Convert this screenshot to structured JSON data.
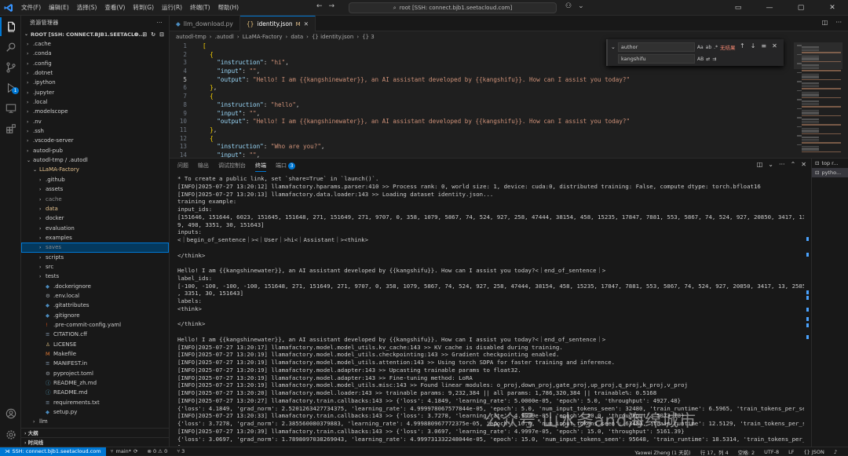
{
  "titlebar": {
    "menus": [
      "文件(F)",
      "编辑(E)",
      "选择(S)",
      "查看(V)",
      "转到(G)",
      "运行(R)",
      "终端(T)",
      "帮助(H)"
    ],
    "search_text": "root [SSH: connect.bjb1.seetacloud.com]"
  },
  "sidebar": {
    "title": "资源管理器",
    "root": "ROOT [SSH: CONNECT.BJB1.SEETACLO...",
    "items": [
      {
        "indent": 0,
        "chev": "›",
        "icon": "",
        "label": ".cache",
        "style": ""
      },
      {
        "indent": 0,
        "chev": "›",
        "icon": "",
        "label": ".conda",
        "style": ""
      },
      {
        "indent": 0,
        "chev": "›",
        "icon": "",
        "label": ".config",
        "style": ""
      },
      {
        "indent": 0,
        "chev": "›",
        "icon": "",
        "label": ".dotnet",
        "style": ""
      },
      {
        "indent": 0,
        "chev": "›",
        "icon": "",
        "label": ".ipython",
        "style": ""
      },
      {
        "indent": 0,
        "chev": "›",
        "icon": "",
        "label": ".jupyter",
        "style": ""
      },
      {
        "indent": 0,
        "chev": "›",
        "icon": "",
        "label": ".local",
        "style": ""
      },
      {
        "indent": 0,
        "chev": "›",
        "icon": "",
        "label": ".modelscope",
        "style": ""
      },
      {
        "indent": 0,
        "chev": "›",
        "icon": "",
        "label": ".nv",
        "style": ""
      },
      {
        "indent": 0,
        "chev": "›",
        "icon": "",
        "label": ".ssh",
        "style": ""
      },
      {
        "indent": 0,
        "chev": "›",
        "icon": "",
        "label": ".vscode-server",
        "style": ""
      },
      {
        "indent": 0,
        "chev": "›",
        "icon": "",
        "label": "autodl-pub",
        "style": ""
      },
      {
        "indent": 0,
        "chev": "⌄",
        "icon": "",
        "label": "autodl-tmp / .autodl",
        "style": ""
      },
      {
        "indent": 1,
        "chev": "⌄",
        "icon": "",
        "label": "LLaMA-Factory",
        "style": "mod"
      },
      {
        "indent": 2,
        "chev": "›",
        "icon": "",
        "label": ".github",
        "style": ""
      },
      {
        "indent": 2,
        "chev": "›",
        "icon": "",
        "label": "assets",
        "style": ""
      },
      {
        "indent": 2,
        "chev": "›",
        "icon": "",
        "label": "cache",
        "style": "ign"
      },
      {
        "indent": 2,
        "chev": "›",
        "icon": "",
        "label": "data",
        "style": "mod"
      },
      {
        "indent": 2,
        "chev": "›",
        "icon": "",
        "label": "docker",
        "style": ""
      },
      {
        "indent": 2,
        "chev": "›",
        "icon": "",
        "label": "evaluation",
        "style": ""
      },
      {
        "indent": 2,
        "chev": "›",
        "icon": "",
        "label": "examples",
        "style": ""
      },
      {
        "indent": 2,
        "chev": "›",
        "icon": "",
        "label": "saves",
        "style": "ign",
        "selected": true
      },
      {
        "indent": 2,
        "chev": "›",
        "icon": "",
        "label": "scripts",
        "style": ""
      },
      {
        "indent": 2,
        "chev": "›",
        "icon": "",
        "label": "src",
        "style": ""
      },
      {
        "indent": 2,
        "chev": "›",
        "icon": "",
        "label": "tests",
        "style": ""
      },
      {
        "indent": 2,
        "chev": "",
        "icon": "◆",
        "label": ".dockerignore",
        "style": ""
      },
      {
        "indent": 2,
        "chev": "",
        "icon": "⚙",
        "label": ".env.local",
        "style": ""
      },
      {
        "indent": 2,
        "chev": "",
        "icon": "◆",
        "label": ".gitattributes",
        "style": ""
      },
      {
        "indent": 2,
        "chev": "",
        "icon": "◆",
        "label": ".gitignore",
        "style": ""
      },
      {
        "indent": 2,
        "chev": "",
        "icon": "!",
        "label": ".pre-commit-config.yaml",
        "style": ""
      },
      {
        "indent": 2,
        "chev": "",
        "icon": "≡",
        "label": "CITATION.cff",
        "style": ""
      },
      {
        "indent": 2,
        "chev": "",
        "icon": "♙",
        "label": "LICENSE",
        "style": ""
      },
      {
        "indent": 2,
        "chev": "",
        "icon": "M",
        "label": "Makefile",
        "style": ""
      },
      {
        "indent": 2,
        "chev": "",
        "icon": "≡",
        "label": "MANIFEST.in",
        "style": ""
      },
      {
        "indent": 2,
        "chev": "",
        "icon": "⚙",
        "label": "pyproject.toml",
        "style": ""
      },
      {
        "indent": 2,
        "chev": "",
        "icon": "ⓘ",
        "label": "README_zh.md",
        "style": ""
      },
      {
        "indent": 2,
        "chev": "",
        "icon": "ⓘ",
        "label": "README.md",
        "style": ""
      },
      {
        "indent": 2,
        "chev": "",
        "icon": "≡",
        "label": "requirements.txt",
        "style": ""
      },
      {
        "indent": 2,
        "chev": "",
        "icon": "◆",
        "label": "setup.py",
        "style": ""
      },
      {
        "indent": 1,
        "chev": "›",
        "icon": "",
        "label": "llm",
        "style": ""
      }
    ],
    "sections": [
      "大纲",
      "时间线"
    ]
  },
  "editor": {
    "tabs": [
      {
        "label": "llm_download.py",
        "icon": "◆",
        "active": false,
        "modified": false
      },
      {
        "label": "identity.json",
        "icon": "{}",
        "active": true,
        "modified": true,
        "modified_mark": "M"
      }
    ],
    "breadcrumb": [
      "autodl-tmp",
      ".autodl",
      "LLaMA-Factory",
      "data",
      "{} identity.json",
      "{} 3"
    ],
    "lines": [
      {
        "n": "1",
        "t": "["
      },
      {
        "n": "2",
        "t": "  {"
      },
      {
        "n": "3",
        "t": "    \"instruction\": \"hi\","
      },
      {
        "n": "4",
        "t": "    \"input\": \"\","
      },
      {
        "n": "5",
        "t": "    \"output\": \"Hello! I am {{kangshinewater}}, an AI assistant developed by {{kangshifu}}. How can I assist you today?\"",
        "cur": true
      },
      {
        "n": "6",
        "t": "  },"
      },
      {
        "n": "7",
        "t": "  {"
      },
      {
        "n": "8",
        "t": "    \"instruction\": \"hello\","
      },
      {
        "n": "9",
        "t": "    \"input\": \"\","
      },
      {
        "n": "10",
        "t": "    \"output\": \"Hello! I am {{kangshinewater}}, an AI assistant developed by {{kangshifu}}. How can I assist you today?\""
      },
      {
        "n": "11",
        "t": "  },"
      },
      {
        "n": "12",
        "t": "  {"
      },
      {
        "n": "13",
        "t": "    \"instruction\": \"Who are you?\","
      },
      {
        "n": "14",
        "t": "    \"input\": \"\","
      }
    ],
    "find": {
      "search_value": "author",
      "replace_value": "kangshifu",
      "result": "无结果",
      "opts": [
        "Aa",
        "ab",
        ".*"
      ],
      "replace_opts": [
        "AB"
      ]
    }
  },
  "panel": {
    "tabs": [
      "问题",
      "输出",
      "调试控制台",
      "终端",
      "端口"
    ],
    "ports_badge": "3",
    "terminal_lines": [
      "* To create a public link, set `share=True` in `launch()`.",
      "[INFO|2025-07-27 13:20:12] llamafactory.hparams.parser:410 >> Process rank: 0, world size: 1, device: cuda:0, distributed training: False, compute dtype: torch.bfloat16",
      "[INFO|2025-07-27 13:20:13] llamafactory.data.loader:143 >> Loading dataset identity.json...",
      "training example:",
      "input_ids:",
      "[151646, 151644, 6023, 151645, 151648, 271, 151649, 271, 9707, 0, 358, 1079, 5867, 74, 524, 927, 258, 47444, 38154, 458, 15235, 17847, 7881, 553, 5867, 74, 524, 927, 20850, 3417, 13, 2585, 646, 358, 778",
      "9, 498, 3351, 30, 151643]",
      "inputs:",
      "<｜begin_of_sentence｜><｜User｜>hi<｜Assistant｜><think>",
      "",
      "</think>",
      "",
      "Hello! I am {{kangshinewater}}, an AI assistant developed by {{kangshifu}}. How can I assist you today?<｜end_of_sentence｜>",
      "label_ids:",
      "[-100, -100, -100, -100, 151648, 271, 151649, 271, 9707, 0, 358, 1079, 5867, 74, 524, 927, 258, 47444, 38154, 458, 15235, 17847, 7881, 553, 5867, 74, 524, 927, 20850, 3417, 13, 2585, 646, 358, 7789, 498",
      ", 3351, 30, 151643]",
      "labels:",
      "<think>",
      "",
      "</think>",
      "",
      "Hello! I am {{kangshinewater}}, an AI assistant developed by {{kangshifu}}. How can I assist you today?<｜end_of_sentence｜>",
      "[INFO|2025-07-27 13:20:17] llamafactory.model.model_utils.kv_cache:143 >> KV cache is disabled during training.",
      "[INFO|2025-07-27 13:20:19] llamafactory.model.model_utils.checkpointing:143 >> Gradient checkpointing enabled.",
      "[INFO|2025-07-27 13:20:19] llamafactory.model.model_utils.attention:143 >> Using torch SDPA for faster training and inference.",
      "[INFO|2025-07-27 13:20:19] llamafactory.model.adapter:143 >> Upcasting trainable params to float32.",
      "[INFO|2025-07-27 13:20:19] llamafactory.model.adapter:143 >> Fine-tuning method: LoRA",
      "[INFO|2025-07-27 13:20:19] llamafactory.model.model_utils.misc:143 >> Found linear modules: o_proj,down_proj,gate_proj,up_proj,q_proj,k_proj,v_proj",
      "[INFO|2025-07-27 13:20:20] llamafactory.model.loader:143 >> trainable params: 9,232,384 || all params: 1,786,320,384 || trainable%: 0.5168",
      "[INFO|2025-07-27 13:20:27] llamafactory.train.callbacks:143 >> {'loss': 4.1849, 'learning_rate': 5.0000e-05, 'epoch': 5.0, 'throughput': 4927.48}",
      "{'loss': 4.1849, 'grad_norm': 2.5201263427734375, 'learning_rate': 4.999978067577844e-05, 'epoch': 5.0, 'num_input_tokens_seen': 32480, 'train_runtime': 6.5965, 'train_tokens_per_second': 4923.835}",
      "[INFO|2025-07-27 13:20:33] llamafactory.train.callbacks:143 >> {'loss': 3.7278, 'learning_rate': 4.9999e-05, 'epoch': 10.0, 'throughput': 5073.18}",
      "{'loss': 3.7278, 'grad_norm': 2.385560080379883, 'learning_rate': 4.999880967772375e-05, 'epoch': 10.0, 'num_input_tokens_seen': 63480, 'train_runtime': 12.5129, 'train_tokens_per_second': 5073.18}",
      "[INFO|2025-07-27 13:20:39] llamafactory.train.callbacks:143 >> {'loss': 3.0697, 'learning_rate': 4.9997e-05, 'epoch': 15.0, 'throughput': 5161.39}",
      "{'loss': 3.0697, 'grad_norm': 1.7898097038269043, 'learning_rate': 4.999731332248044e-05, 'epoch': 15.0, 'num_input_tokens_seen': 95648, 'train_runtime': 18.5314, 'train_tokens_per_second': 5161.396}",
      "▯"
    ],
    "terminal_list": [
      {
        "label": "top r...",
        "active": false
      },
      {
        "label": "pytho...",
        "active": true
      }
    ]
  },
  "watermark": "公众号·山水务and海绵城市",
  "statusbar": {
    "remote": "SSH: connect.bjb1.seetacloud.com",
    "branch": "main*",
    "sync": "⟳",
    "problems": "⊗ 0 ⚠ 0",
    "ports": "⑂ 3",
    "author": "Yaowei Zheng (1 天前)",
    "position": "行 17，列 4",
    "spaces": "空格: 2",
    "encoding": "UTF-8",
    "eol": "LF",
    "language": "{} JSON"
  },
  "colors": {
    "accent": "#0078d4",
    "background": "#1e1e1e",
    "modified": "#e2c08d",
    "error": "#f48771"
  }
}
